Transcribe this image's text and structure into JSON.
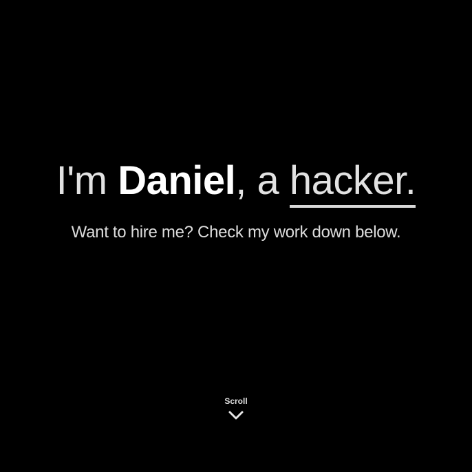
{
  "hero": {
    "greeting": "I'm ",
    "name": "Daniel",
    "connector": ", a ",
    "role": "hacker.",
    "subtitle": "Want to hire me? Check my work down below."
  },
  "scroll_cue": {
    "label": "Scroll",
    "icon": "chevron-down-icon"
  }
}
